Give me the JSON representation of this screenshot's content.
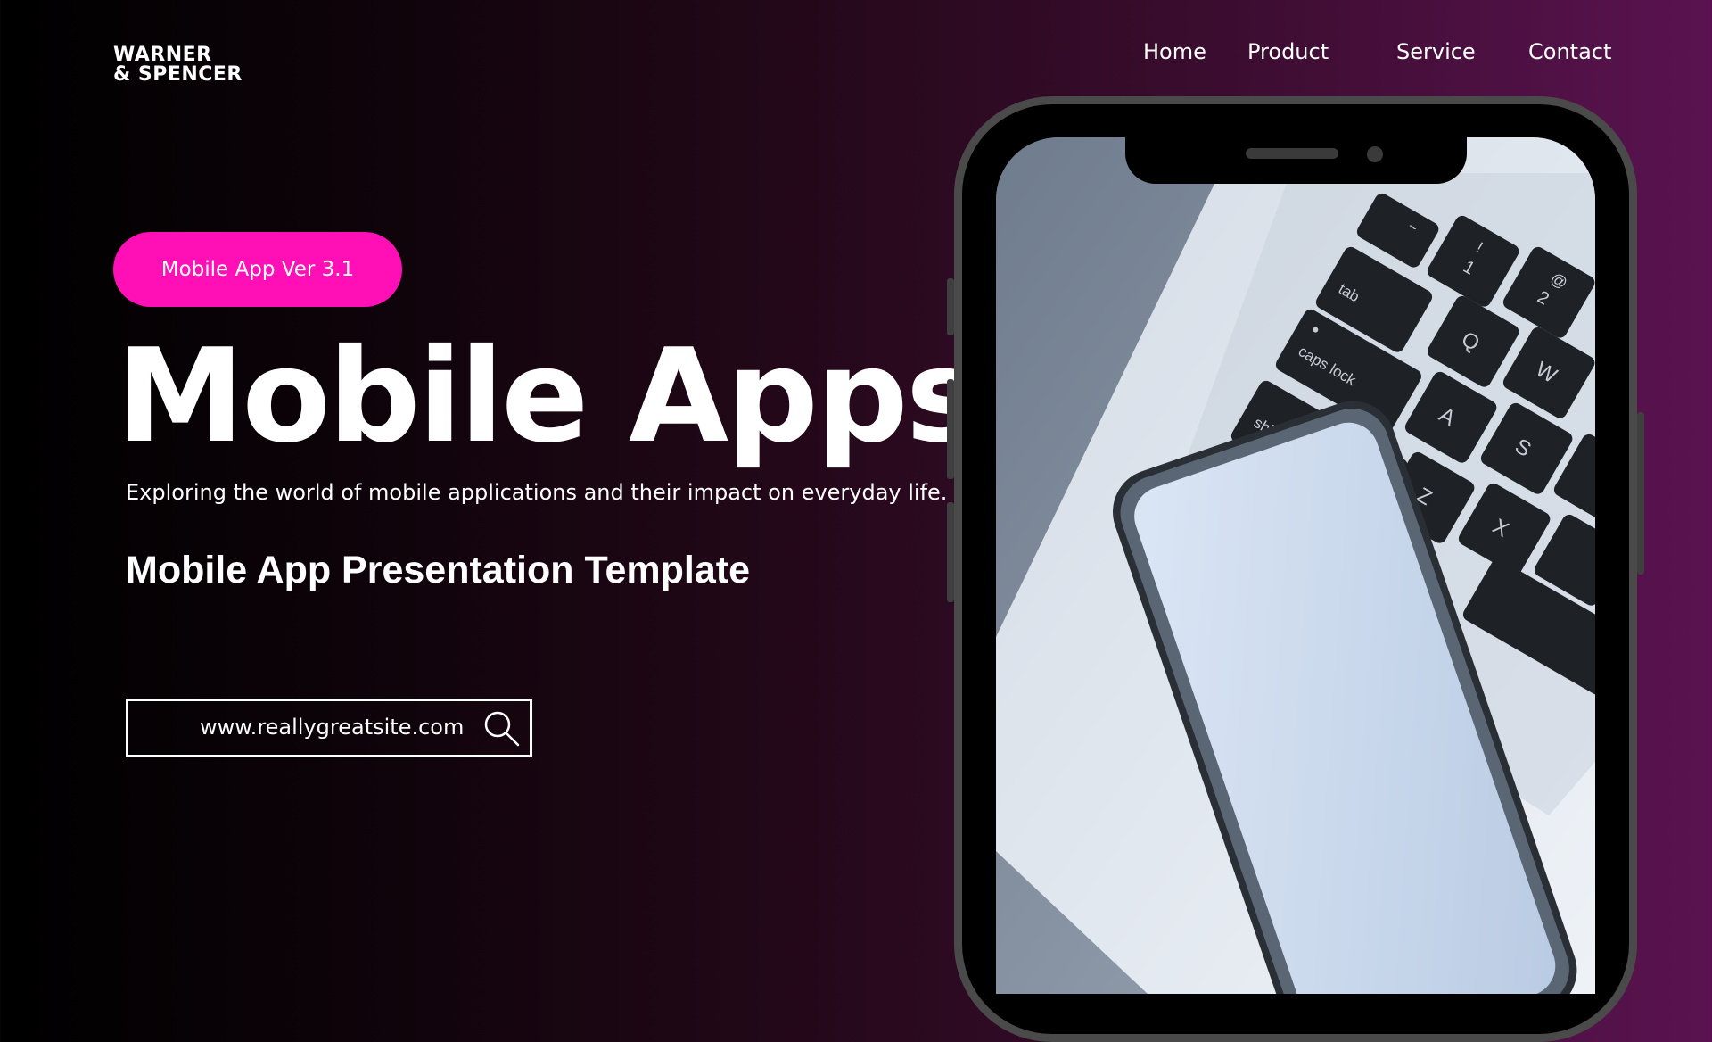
{
  "brand": {
    "line1": "WARNER",
    "line2": "& SPENCER"
  },
  "nav": {
    "home": "Home",
    "product": "Product",
    "service": "Service",
    "contact": "Contact"
  },
  "hero": {
    "badge": "Mobile App Ver 3.1",
    "title": "Mobile Apps",
    "subtitle": "Exploring the world of mobile applications and their impact on everyday life.",
    "template_title": "Mobile App Presentation Template"
  },
  "search": {
    "value": "www.reallygreatsite.com",
    "icon": "search-icon"
  },
  "keyboard_keys": [
    "~",
    "!",
    "1",
    "@",
    "2",
    "tab",
    "Q",
    "W",
    "caps lock",
    "A",
    "S",
    "Z",
    "X",
    "shift"
  ],
  "colors": {
    "accent": "#ff10b6",
    "background_dark": "#000000",
    "background_purple": "#5a1350",
    "text": "#ffffff"
  }
}
